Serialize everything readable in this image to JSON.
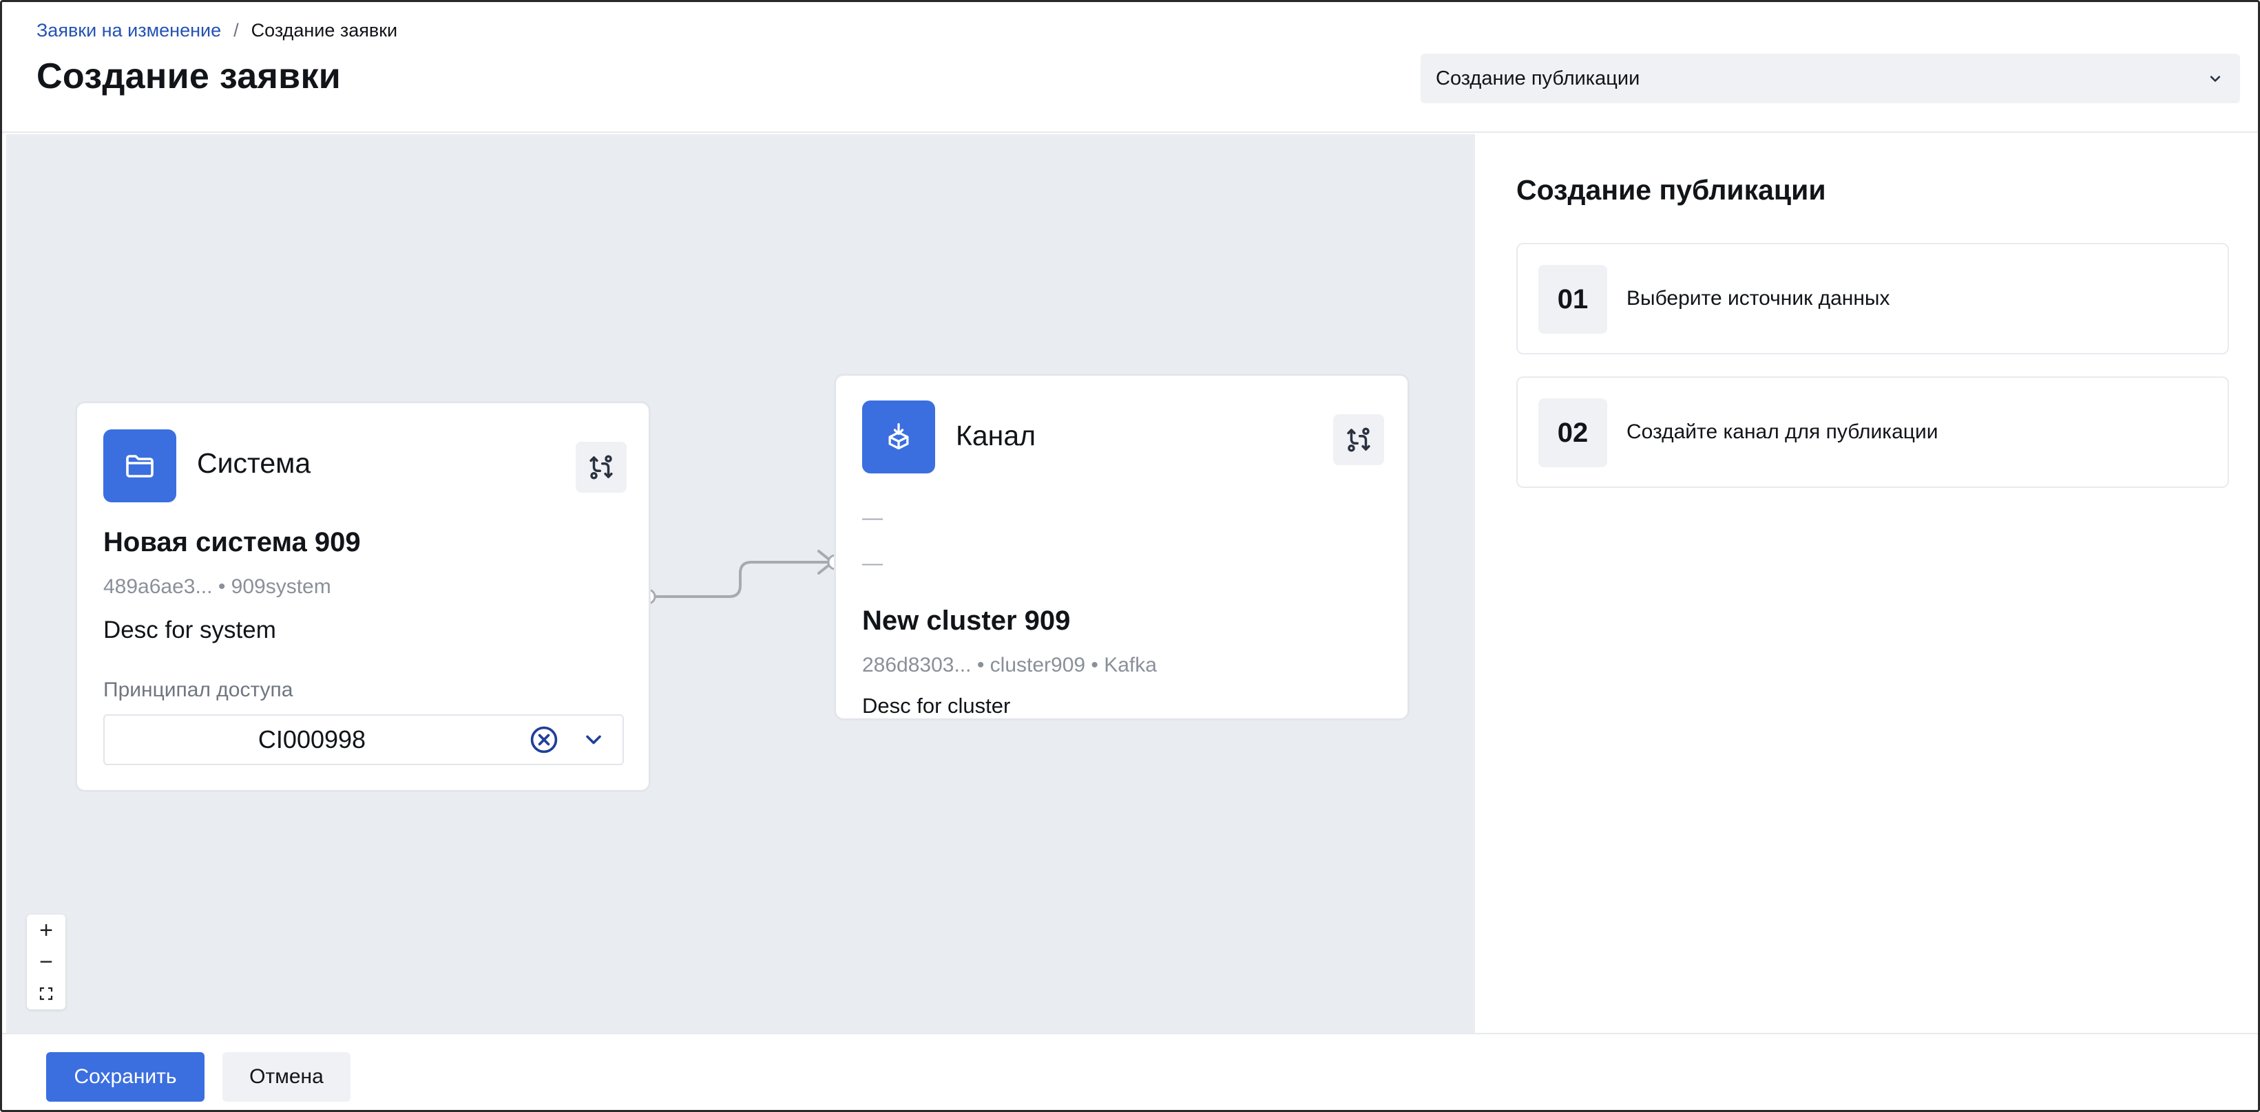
{
  "breadcrumb": {
    "parent": "Заявки на изменение",
    "separator": "/",
    "current": "Создание заявки"
  },
  "page": {
    "title": "Создание заявки"
  },
  "mode_select": {
    "value": "Создание публикации",
    "icon": "chevron-down-icon"
  },
  "system_node": {
    "type_label": "Система",
    "icon": "folder-icon",
    "swap_icon": "swap-icon",
    "name": "Новая система 909",
    "meta": "489a6ae3... • 909system",
    "description": "Desc for system",
    "principal_label": "Принципал доступа",
    "principal_value": "CI000998"
  },
  "channel_node": {
    "type_label": "Канал",
    "icon": "cube-download-icon",
    "swap_icon": "swap-icon",
    "dash_1": "—",
    "dash_2": "—",
    "name": "New cluster 909",
    "meta": "286d8303... • cluster909 • Kafka",
    "description": "Desc for cluster"
  },
  "zoom_controls": {
    "zoom_in": "+",
    "zoom_out": "−",
    "fit_icon": "fit-view-icon"
  },
  "panel": {
    "title": "Создание публикации",
    "steps": [
      {
        "number": "01",
        "label": "Выберите источник данных"
      },
      {
        "number": "02",
        "label": "Создайте канал для публикации"
      }
    ]
  },
  "footer": {
    "save_label": "Сохранить",
    "cancel_label": "Отмена"
  },
  "colors": {
    "accent": "#3b6fe0",
    "link": "#2452b5",
    "canvas_bg": "#e9edf1"
  }
}
